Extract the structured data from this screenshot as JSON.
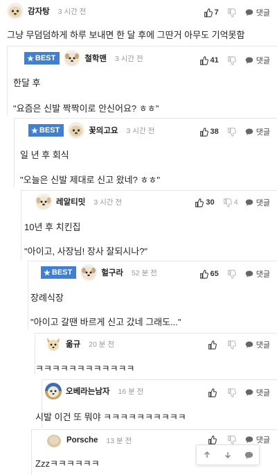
{
  "comments": [
    {
      "nick": "감자탕",
      "time": "3 시간 전",
      "best": false,
      "up": "7",
      "down": "",
      "reply": "댓글",
      "lines": [
        "그냥 무덤덤하게 하루 보내면 한 달 후에 그딴거 아무도 기억못함"
      ]
    },
    {
      "nick": "철학맨",
      "time": "3 시간 전",
      "best": true,
      "up": "41",
      "down": "",
      "reply": "댓글",
      "lines": [
        "한달 후",
        "\"요즘은 신발 짝짝이로 안신어요? ㅎㅎ\""
      ]
    },
    {
      "nick": "꽃의고요",
      "time": "3 시간 전",
      "best": true,
      "up": "38",
      "down": "",
      "reply": "댓글",
      "lines": [
        "일 년 후 회식",
        "\"오늘은 신발 제대로 신고 왔네? ㅎㅎ\""
      ]
    },
    {
      "nick": "레알티밋",
      "time": "3 시간 전",
      "best": false,
      "up": "30",
      "down": "4",
      "reply": "댓글",
      "lines": [
        "10년 후 치킨집",
        "\"아이고, 사장님! 장사 잘되시나?\""
      ]
    },
    {
      "nick": "헐구라",
      "time": "52 분 전",
      "best": true,
      "up": "65",
      "down": "",
      "reply": "댓글",
      "lines": [
        "장례식장",
        "\"아이고 갈땐 바르게 신고 갔네 그래도...\""
      ]
    },
    {
      "nick": "옮규",
      "time": "20 분 전",
      "best": false,
      "up": "",
      "down": "",
      "reply": "댓글",
      "lines": [
        "ㅋㅋㅋㅋㅋㅋㅋㅋㅋㅋㅋㅋ"
      ]
    },
    {
      "nick": "오베라는남자",
      "time": "16 분 전",
      "best": false,
      "up": "",
      "down": "",
      "reply": "댓글",
      "lines": [
        "시발 이건 또 뭐야 ㅋㅋㅋㅋㅋㅋㅋㅋㅋㅋ"
      ]
    },
    {
      "nick": "Porsche",
      "time": "13 분 전",
      "best": false,
      "up": "",
      "down": "",
      "reply": "댓글",
      "lines": [
        "Zzzㅋㅋㅋㅋㅋㅋ"
      ]
    }
  ],
  "best_label": "BEST",
  "colors": {
    "best_badge": "#3d7fd9",
    "border": "#e6e6e6",
    "muted": "#999999"
  },
  "icons": {
    "up": "thumbs-up-icon",
    "down": "thumbs-down-icon",
    "reply": "speech-bubble-icon",
    "scroll_up": "arrow-up-icon",
    "scroll_down": "arrow-down-icon"
  }
}
